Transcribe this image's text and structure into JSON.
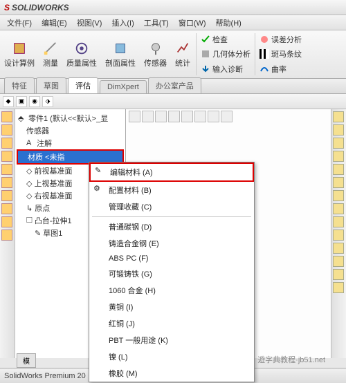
{
  "title": {
    "logo1": "S",
    "logo2": "SOLIDWORKS"
  },
  "menu": [
    "文件(F)",
    "编辑(E)",
    "视图(V)",
    "插入(I)",
    "工具(T)",
    "窗口(W)",
    "帮助(H)"
  ],
  "ribbon": {
    "big": [
      {
        "label": "设计算例"
      },
      {
        "label": "测量"
      },
      {
        "label": "质量属性"
      },
      {
        "label": "剖面属性"
      },
      {
        "label": "传感器"
      },
      {
        "label": "统计"
      }
    ],
    "side": [
      {
        "label": "检查"
      },
      {
        "label": "几何体分析"
      },
      {
        "label": "输入诊断"
      },
      {
        "label": "误差分析"
      },
      {
        "label": "斑马条纹"
      },
      {
        "label": "曲率"
      }
    ]
  },
  "tabs": [
    "特征",
    "草图",
    "评估",
    "DimXpert",
    "办公室产品"
  ],
  "active_tab": "评估",
  "tree": {
    "root": "零件1 (默认<<默认>_显",
    "items": [
      {
        "label": "传感器"
      },
      {
        "label": "注解"
      },
      {
        "label": "材质 <未指",
        "selected": true
      },
      {
        "label": "前视基准面"
      },
      {
        "label": "上视基准面"
      },
      {
        "label": "右视基准面"
      },
      {
        "label": "原点"
      },
      {
        "label": "凸台-拉伸1"
      },
      {
        "label": "草图1",
        "indent": true
      }
    ]
  },
  "context_menu": [
    {
      "label": "编辑材料 (A)",
      "highlight": true
    },
    {
      "label": "配置材料 (B)"
    },
    {
      "label": "管理收藏 (C)"
    },
    {
      "sep": true
    },
    {
      "label": "普通碳钢 (D)"
    },
    {
      "label": "铸造合金钢 (E)"
    },
    {
      "label": "ABS PC (F)"
    },
    {
      "label": "可锻铸铁 (G)"
    },
    {
      "label": "1060 合金 (H)"
    },
    {
      "label": "黄铜 (I)"
    },
    {
      "label": "红铜 (J)"
    },
    {
      "label": "PBT 一般用途 (K)"
    },
    {
      "label": "镍 (L)"
    },
    {
      "label": "橡胶 (M)"
    }
  ],
  "bottom_tab": "模",
  "status": "SolidWorks Premium 20",
  "watermark": "遊字典教程·jb51.net"
}
